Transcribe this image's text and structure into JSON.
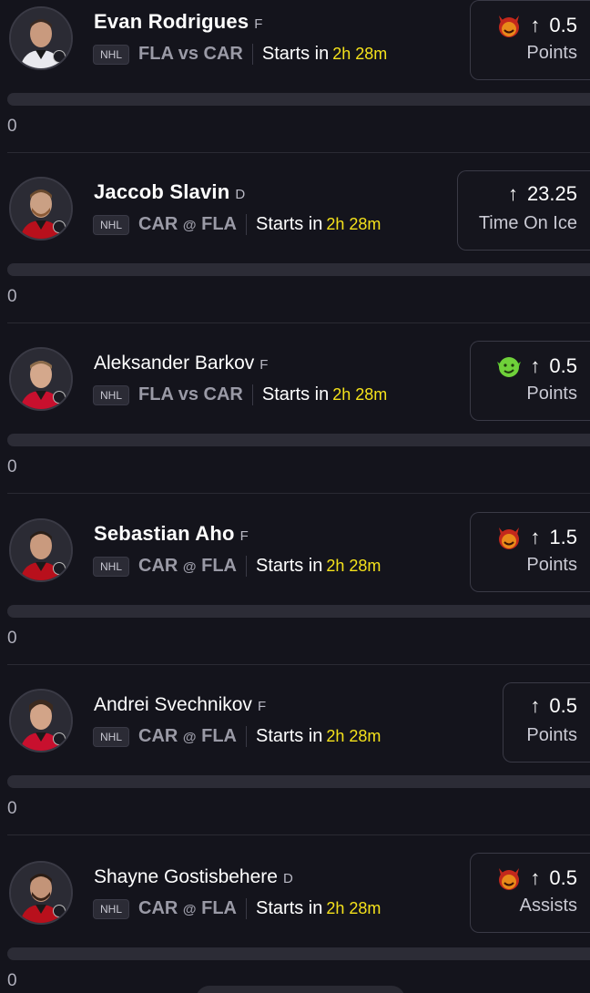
{
  "players": [
    {
      "name": "Evan Rodrigues",
      "position": "F",
      "league": "NHL",
      "team": "FLA",
      "separator": "vs",
      "opponent": "CAR",
      "starts_label": "Starts in",
      "starts_time": "2h 28m",
      "line": "0.5",
      "stat": "Points",
      "emoji": "devil-red",
      "count": "0"
    },
    {
      "name": "Jaccob Slavin",
      "position": "D",
      "league": "NHL",
      "team": "CAR",
      "separator": "@",
      "opponent": "FLA",
      "starts_label": "Starts in",
      "starts_time": "2h 28m",
      "line": "23.25",
      "stat": "Time On Ice",
      "emoji": "",
      "count": "0"
    },
    {
      "name": "Aleksander Barkov",
      "position": "F",
      "league": "NHL",
      "team": "FLA",
      "separator": "vs",
      "opponent": "CAR",
      "starts_label": "Starts in",
      "starts_time": "2h 28m",
      "line": "0.5",
      "stat": "Points",
      "emoji": "goblin-green",
      "count": "0"
    },
    {
      "name": "Sebastian Aho",
      "position": "F",
      "league": "NHL",
      "team": "CAR",
      "separator": "@",
      "opponent": "FLA",
      "starts_label": "Starts in",
      "starts_time": "2h 28m",
      "line": "1.5",
      "stat": "Points",
      "emoji": "devil-red",
      "count": "0"
    },
    {
      "name": "Andrei Svechnikov",
      "position": "F",
      "league": "NHL",
      "team": "CAR",
      "separator": "@",
      "opponent": "FLA",
      "starts_label": "Starts in",
      "starts_time": "2h 28m",
      "line": "0.5",
      "stat": "Points",
      "emoji": "",
      "count": "0"
    },
    {
      "name": "Shayne Gostisbehere",
      "position": "D",
      "league": "NHL",
      "team": "CAR",
      "separator": "@",
      "opponent": "FLA",
      "starts_label": "Starts in",
      "starts_time": "2h 28m",
      "line": "0.5",
      "stat": "Assists",
      "emoji": "devil-red",
      "count": "0"
    }
  ],
  "colors": {
    "background": "#14141c",
    "accent_time": "#f5e21b",
    "matchup": "#9a9aa6"
  },
  "icons": {
    "arrow": "arrow-up-icon",
    "devil": "devil-emoji-icon",
    "goblin": "goblin-emoji-icon",
    "clock": "clock-icon"
  }
}
